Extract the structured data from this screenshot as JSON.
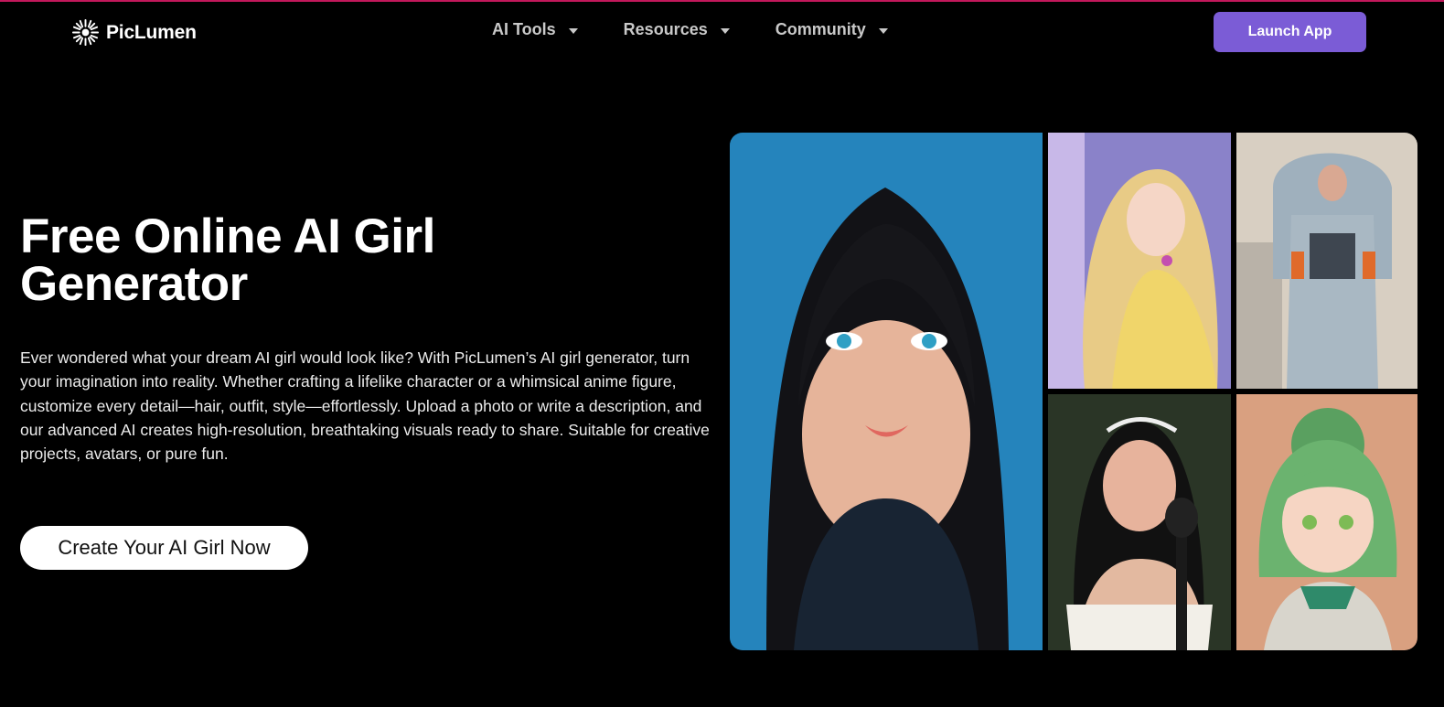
{
  "brand": {
    "name": "PicLumen",
    "icon": "starburst-logo-icon"
  },
  "nav": {
    "items": [
      {
        "label": "AI Tools"
      },
      {
        "label": "Resources"
      },
      {
        "label": "Community"
      }
    ],
    "launch_label": "Launch App"
  },
  "hero": {
    "title_line1": "Free Online AI Girl",
    "title_line2": "Generator",
    "description": "Ever wondered what your dream AI girl would look like? With PicLumen’s AI girl generator, turn your imagination into reality. Whether crafting a lifelike character or a whimsical anime figure, customize every detail—hair, outfit, style—effortlessly. Upload a photo or write a description, and our advanced AI creates high-resolution, breathtaking visuals ready to share. Suitable for creative projects, avatars, or pure fun.",
    "cta_label": "Create Your AI Girl Now"
  },
  "colors": {
    "background": "#000000",
    "accent": "#7b5cd6",
    "top_line": "#c2185b",
    "nav_text": "#c9c9c9"
  }
}
